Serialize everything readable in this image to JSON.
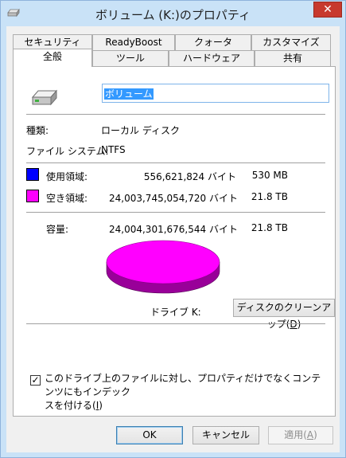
{
  "window": {
    "title": "ボリューム (K:)のプロパティ",
    "close_glyph": "✕"
  },
  "tabs_row1": [
    "セキュリティ",
    "ReadyBoost",
    "クォータ",
    "カスタマイズ"
  ],
  "tabs_row2": [
    "全般",
    "ツール",
    "ハードウェア",
    "共有"
  ],
  "general": {
    "volume_name": "ボリューム",
    "type_label": "種類:",
    "type_value": "ローカル ディスク",
    "fs_label": "ファイル システム:",
    "fs_value": "NTFS",
    "used_label": "使用領域:",
    "used_bytes": "556,621,824 バイト",
    "used_size": "530 MB",
    "free_label": "空き領域:",
    "free_bytes": "24,003,745,054,720 バイト",
    "free_size": "21.8 TB",
    "capacity_label": "容量:",
    "capacity_bytes": "24,004,301,676,544 バイト",
    "capacity_size": "21.8 TB",
    "drive_label": "ドライブ K:",
    "cleanup_label": "ディスクのクリーンアップ(",
    "cleanup_key": "D",
    "cleanup_close": ")",
    "index_checked": true,
    "index_check_glyph": "✓",
    "index_label_line1": "このドライブ上のファイルに対し、プロパティだけでなくコンテンツにもインデック",
    "index_label_line2": "スを付ける(",
    "index_key": "I",
    "index_close": ")"
  },
  "colors": {
    "used": "#0000ff",
    "free": "#ff00ff",
    "free_dark": "#990099",
    "used_dark": "#000099"
  },
  "usage_fraction_used": 2.32e-05,
  "buttons": {
    "ok": "OK",
    "cancel": "キャンセル",
    "apply": "適用(",
    "apply_key": "A",
    "apply_close": ")"
  }
}
